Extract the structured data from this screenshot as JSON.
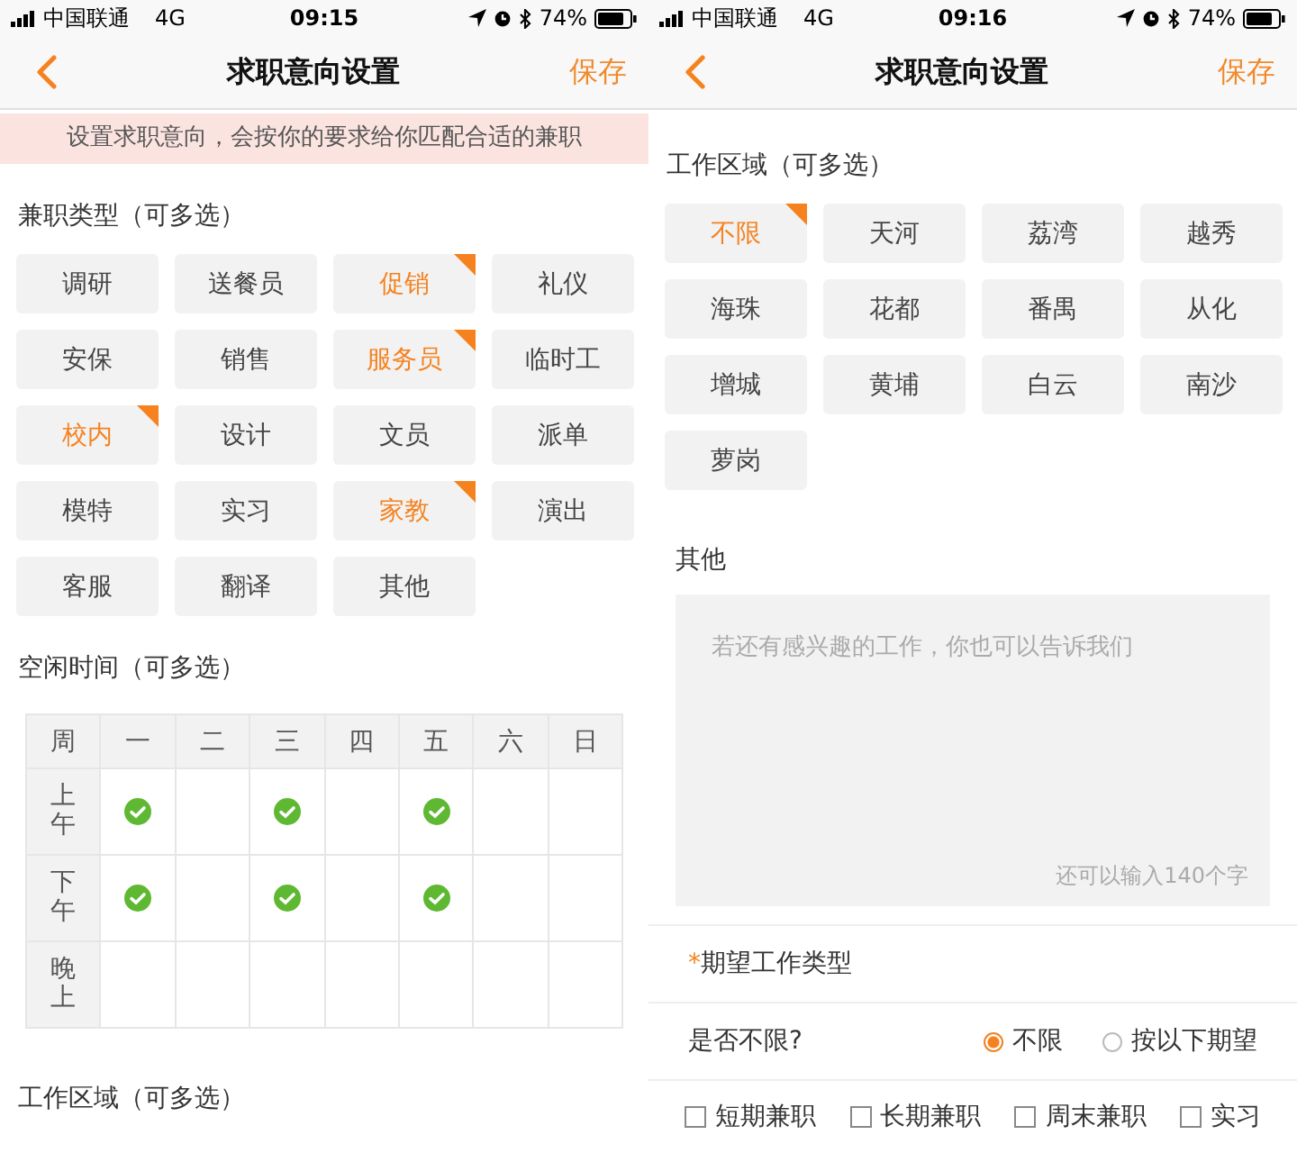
{
  "screens": [
    {
      "status": {
        "carrier": "中国联通",
        "network": "4G",
        "time": "09:15",
        "battery": "74%"
      },
      "nav": {
        "title": "求职意向设置",
        "action": "保存"
      },
      "notice": "设置求职意向，会按你的要求给你匹配合适的兼职",
      "sections": [
        {
          "kind": "chips",
          "title": "兼职类型（可多选）",
          "chips": [
            {
              "label": "调研",
              "selected": false
            },
            {
              "label": "送餐员",
              "selected": false
            },
            {
              "label": "促销",
              "selected": true
            },
            {
              "label": "礼仪",
              "selected": false
            },
            {
              "label": "安保",
              "selected": false
            },
            {
              "label": "销售",
              "selected": false
            },
            {
              "label": "服务员",
              "selected": true
            },
            {
              "label": "临时工",
              "selected": false
            },
            {
              "label": "校内",
              "selected": true
            },
            {
              "label": "设计",
              "selected": false
            },
            {
              "label": "文员",
              "selected": false
            },
            {
              "label": "派单",
              "selected": false
            },
            {
              "label": "模特",
              "selected": false
            },
            {
              "label": "实习",
              "selected": false
            },
            {
              "label": "家教",
              "selected": true
            },
            {
              "label": "演出",
              "selected": false
            },
            {
              "label": "客服",
              "selected": false
            },
            {
              "label": "翻译",
              "selected": false
            },
            {
              "label": "其他",
              "selected": false
            }
          ]
        },
        {
          "kind": "schedule",
          "title": "空闲时间（可多选）",
          "corner": "周",
          "columns": [
            "一",
            "二",
            "三",
            "四",
            "五",
            "六",
            "日"
          ],
          "rows": [
            {
              "label": "上午",
              "slots": [
                true,
                false,
                true,
                false,
                true,
                false,
                false
              ]
            },
            {
              "label": "下午",
              "slots": [
                true,
                false,
                true,
                false,
                true,
                false,
                false
              ]
            },
            {
              "label": "晚上",
              "slots": [
                false,
                false,
                false,
                false,
                false,
                false,
                false
              ]
            }
          ]
        },
        {
          "kind": "heading",
          "title": "工作区域（可多选）"
        }
      ]
    },
    {
      "status": {
        "carrier": "中国联通",
        "network": "4G",
        "time": "09:16",
        "battery": "74%"
      },
      "nav": {
        "title": "求职意向设置",
        "action": "保存"
      },
      "sections": [
        {
          "kind": "chips",
          "title": "工作区域（可多选）",
          "chips": [
            {
              "label": "不限",
              "selected": true
            },
            {
              "label": "天河",
              "selected": false
            },
            {
              "label": "荔湾",
              "selected": false
            },
            {
              "label": "越秀",
              "selected": false
            },
            {
              "label": "海珠",
              "selected": false
            },
            {
              "label": "花都",
              "selected": false
            },
            {
              "label": "番禺",
              "selected": false
            },
            {
              "label": "从化",
              "selected": false
            },
            {
              "label": "增城",
              "selected": false
            },
            {
              "label": "黄埔",
              "selected": false
            },
            {
              "label": "白云",
              "selected": false
            },
            {
              "label": "南沙",
              "selected": false
            },
            {
              "label": "萝岗",
              "selected": false
            }
          ]
        },
        {
          "kind": "textarea",
          "title": "其他",
          "placeholder": "若还有感兴趣的工作，你也可以告诉我们",
          "counter": "还可以输入140个字"
        },
        {
          "kind": "choice",
          "title": "期望工作类型",
          "required_mark": "*",
          "question": "是否不限?",
          "options": [
            {
              "label": "不限",
              "selected": true
            },
            {
              "label": "按以下期望",
              "selected": false
            }
          ],
          "checkboxes": [
            {
              "label": "短期兼职",
              "checked": false
            },
            {
              "label": "长期兼职",
              "checked": false
            },
            {
              "label": "周末兼职",
              "checked": false
            },
            {
              "label": "实习",
              "checked": false
            }
          ]
        }
      ]
    }
  ]
}
